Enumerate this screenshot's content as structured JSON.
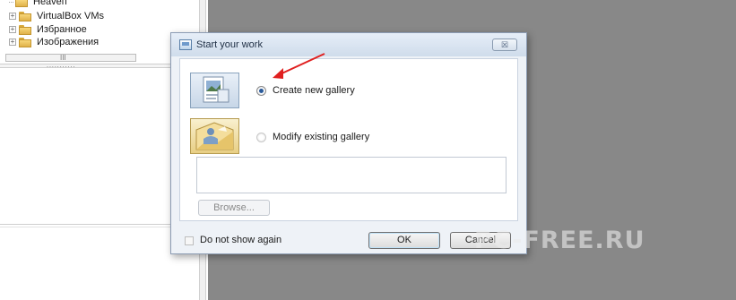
{
  "explorer": {
    "tree_items": [
      {
        "label": "Неаvеп",
        "icon": "folder-icon"
      },
      {
        "label": "VirtualBox VMs",
        "icon": "folder-icon"
      },
      {
        "label": "Избранное",
        "icon": "folder-star-icon"
      },
      {
        "label": "Изображения",
        "icon": "folder-pictures-icon"
      }
    ],
    "scroll_grip": "III",
    "splitter_grip": "..........."
  },
  "dialog": {
    "title": "Start your work",
    "close_label": "☒",
    "options": [
      {
        "label": "Create new gallery",
        "checked": true,
        "icon": "new-gallery-icon"
      },
      {
        "label": "Modify existing gallery",
        "checked": false,
        "icon": "existing-gallery-icon"
      }
    ],
    "path_value": "",
    "browse_label": "Browse...",
    "do_not_show_label": "Do not show again",
    "ok_label": "OK",
    "cancel_label": "Cancel"
  },
  "watermark": "PC-FREE.RU",
  "colors": {
    "workspace": "#888888",
    "annotation_arrow": "#e02020",
    "dialog_bg": "#eef2f7"
  }
}
